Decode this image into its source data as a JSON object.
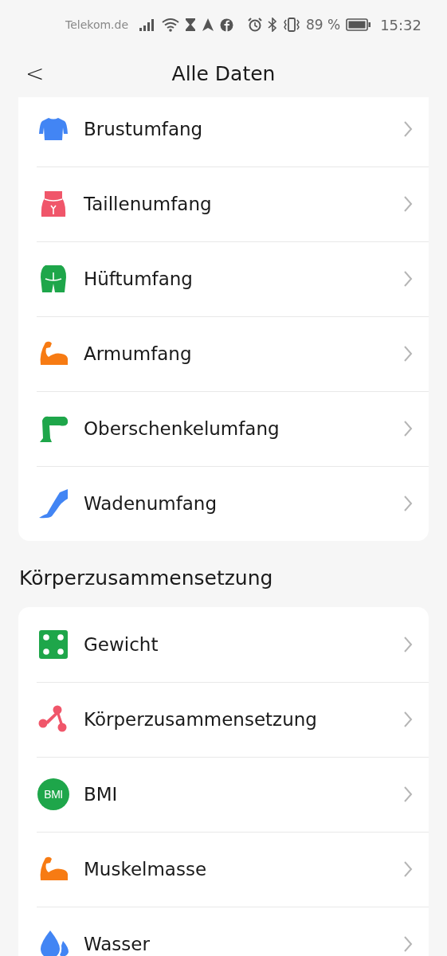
{
  "status_bar": {
    "carrier": "Telekom.de",
    "battery_text": "89 %",
    "time": "15:32"
  },
  "header": {
    "back": "<",
    "title": "Alle Daten"
  },
  "sections": [
    {
      "items": [
        {
          "label": "Brustumfang",
          "kind": "chest",
          "color": "#4285f4"
        },
        {
          "label": "Taillenumfang",
          "kind": "waist",
          "color": "#f0566a"
        },
        {
          "label": "Hüftumfang",
          "kind": "hip",
          "color": "#1ea64a"
        },
        {
          "label": "Armumfang",
          "kind": "arm",
          "color": "#f77b13"
        },
        {
          "label": "Oberschenkelumfang",
          "kind": "thigh",
          "color": "#1ea64a"
        },
        {
          "label": "Wadenumfang",
          "kind": "calf",
          "color": "#4285f4"
        }
      ]
    },
    {
      "title": "Körperzusammensetzung",
      "items": [
        {
          "label": "Gewicht",
          "kind": "scale",
          "color": "#1ea64a"
        },
        {
          "label": "Körperzusammensetzung",
          "kind": "molecule",
          "color": "#f0566a"
        },
        {
          "label": "BMI",
          "kind": "badge",
          "icon_text": "BMI",
          "color": "#1ea64a"
        },
        {
          "label": "Muskelmasse",
          "kind": "arm",
          "color": "#f77b13"
        },
        {
          "label": "Wasser",
          "kind": "drops",
          "color": "#4285f4"
        }
      ]
    }
  ]
}
